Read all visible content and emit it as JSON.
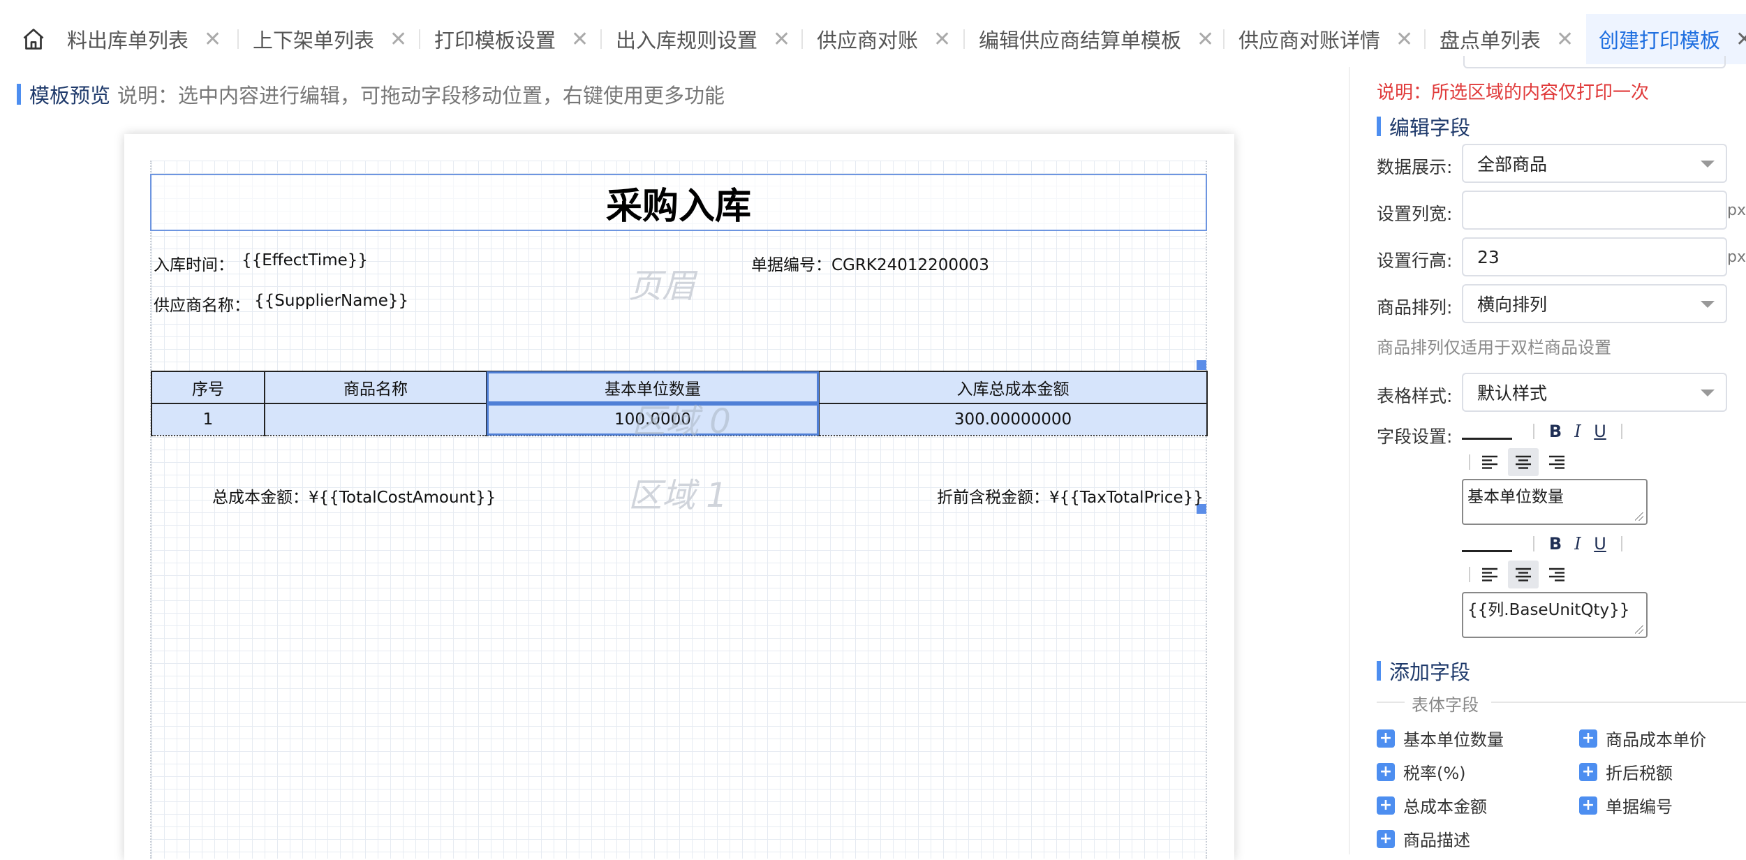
{
  "tabs": [
    {
      "label": "料出库单列表",
      "close": "✕"
    },
    {
      "label": "上下架单列表",
      "close": "✕"
    },
    {
      "label": "打印模板设置",
      "close": "✕"
    },
    {
      "label": "出入库规则设置",
      "close": "✕"
    },
    {
      "label": "供应商对账",
      "close": "✕"
    },
    {
      "label": "编辑供应商结算单模板",
      "close": "✕"
    },
    {
      "label": "供应商对账详情",
      "close": "✕"
    },
    {
      "label": "盘点单列表",
      "close": "✕"
    },
    {
      "label": "创建打印模板",
      "close": "✕"
    }
  ],
  "preview": {
    "title": "模板预览",
    "description": "说明：选中内容进行编辑，可拖动字段移动位置，右键使用更多功能"
  },
  "document": {
    "title": "采购入库",
    "header_ghost": "页眉",
    "inbound_time_label": "入库时间：",
    "inbound_time_value": "{{EffectTime}}",
    "doc_no": "单据编号：CGRK24012200003",
    "supplier_label": "供应商名称：",
    "supplier_value": "{{SupplierName}}",
    "table": {
      "headers": [
        "序号",
        "商品名称",
        "基本单位数量",
        "入库总成本金额"
      ],
      "rows": [
        [
          "1",
          "",
          "100.0000",
          "300.00000000"
        ]
      ]
    },
    "region0_ghost": "区域 0",
    "region1_ghost": "区域 1",
    "total_cost": "总成本金额：¥{{TotalCostAmount}}",
    "tax_total": "折前含税金额：¥{{TaxTotalPrice}}"
  },
  "panel": {
    "note": "说明：所选区域的内容仅打印一次",
    "edit_section": "编辑字段",
    "data_display_label": "数据展示:",
    "data_display_value": "全部商品",
    "col_width_label": "设置列宽:",
    "col_width_value": "",
    "row_height_label": "设置行高:",
    "row_height_value": "23",
    "unit": "px",
    "product_arrange_label": "商品排列:",
    "product_arrange_value": "横向排列",
    "arrange_hint": "商品排列仅适用于双栏商品设置",
    "table_style_label": "表格样式:",
    "table_style_value": "默认样式",
    "field_settings_label": "字段设置:",
    "fmt_bold": "B",
    "fmt_italic": "I",
    "fmt_underline": "U",
    "header_text": "基本单位数量",
    "cell_text": "{{列.BaseUnitQty}}",
    "add_section": "添加字段",
    "field_group": "表体字段",
    "add_fields": [
      "基本单位数量",
      "商品成本单价",
      "税率(%)",
      "折后税额",
      "总成本金额",
      "单据编号",
      "商品描述"
    ],
    "add_icon": "+"
  },
  "icons": {
    "home": "home-icon",
    "close": "close-icon",
    "align_left": "align-left-icon",
    "align_center": "align-center-icon",
    "align_right": "align-right-icon",
    "caret": "chevron-down-icon",
    "plus": "plus-icon"
  },
  "colors": {
    "accent": "#4d8ef0",
    "active_tab_text": "#1f6fe0",
    "note_red": "#e03a3a",
    "table_fill": "#d6e4fb"
  }
}
